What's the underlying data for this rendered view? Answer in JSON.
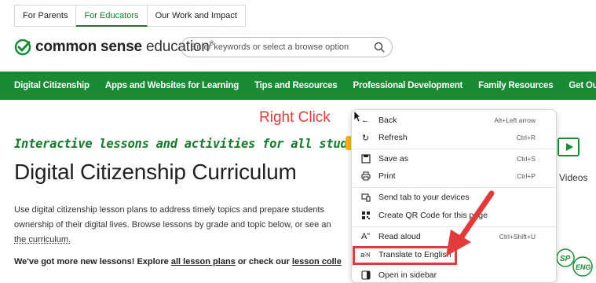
{
  "top_tabs": [
    {
      "label": "For Parents"
    },
    {
      "label": "For Educators"
    },
    {
      "label": "Our Work and Impact"
    }
  ],
  "logo": {
    "bold": "common sense",
    "light": "education",
    "sup": "®"
  },
  "search": {
    "placeholder": "Enter keywords or select a browse option",
    "icon": "search-icon"
  },
  "nav": [
    "Digital Citizenship",
    "Apps and Websites for Learning",
    "Tips and Resources",
    "Professional Development",
    "Family Resources",
    "Get Our News"
  ],
  "hero": {
    "tagline": "Interactive lessons and activities for all students!",
    "title": "Digital Citizenship Curriculum",
    "desc_line1": "Use digital citizenship lesson plans to address timely topics and prepare students",
    "desc_line2": "ownership of their digital lives. Browse lessons by grade and topic below, or see an",
    "desc_line3": "the curriculum.",
    "news_pre": "We've got more new lessons! Explore ",
    "news_link1": "all lesson plans",
    "news_mid": " or check our ",
    "news_link2": "lesson colle"
  },
  "annotation": {
    "right_click": "Right Click"
  },
  "videos": {
    "label": "Videos"
  },
  "context_menu": {
    "items": [
      {
        "label": "Back",
        "shortcut": "Alt+Left arrow",
        "icon": "back-arrow-icon"
      },
      {
        "label": "Refresh",
        "shortcut": "Ctrl+R",
        "icon": "refresh-icon"
      },
      {
        "label": "Save as",
        "shortcut": "Ctrl+S",
        "icon": "save-icon"
      },
      {
        "label": "Print",
        "shortcut": "Ctrl+P",
        "icon": "print-icon"
      },
      {
        "label": "Send tab to your devices",
        "shortcut": "",
        "icon": "send-devices-icon"
      },
      {
        "label": "Create QR Code for this page",
        "shortcut": "",
        "icon": "qr-code-icon"
      },
      {
        "label": "Read aloud",
        "shortcut": "Ctrl+Shift+U",
        "icon": "read-aloud-icon"
      },
      {
        "label": "Translate to English",
        "shortcut": "",
        "icon": "translate-icon"
      },
      {
        "label": "Open in sidebar",
        "shortcut": "",
        "icon": "sidebar-icon"
      }
    ]
  },
  "colors": {
    "brand_green": "#1a8a34",
    "annotation_red": "#e23b3b"
  }
}
